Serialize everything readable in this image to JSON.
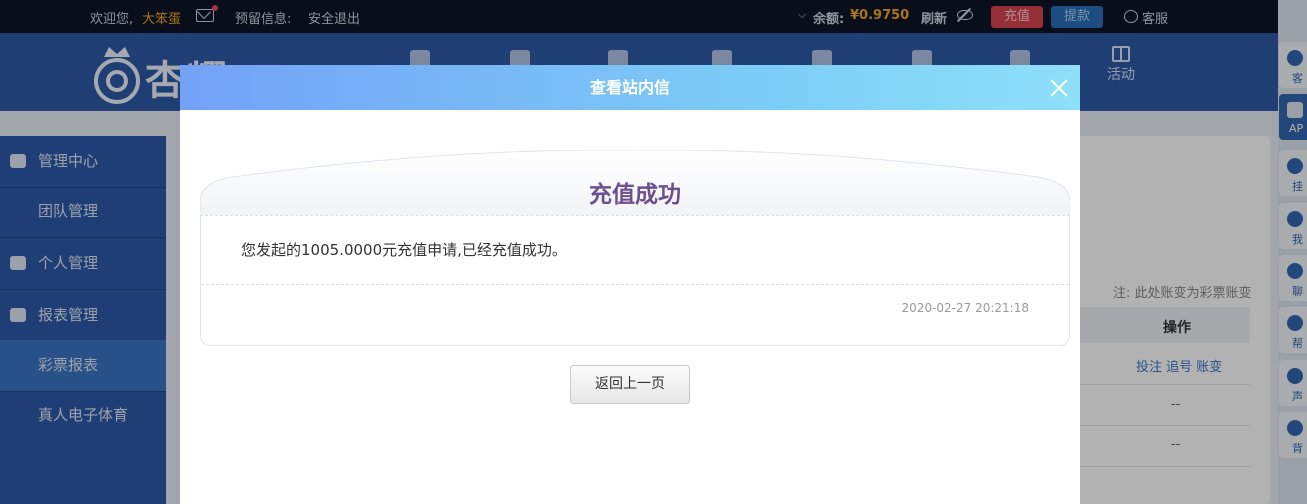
{
  "topbar": {
    "welcome": "欢迎您,",
    "username": "大笨蛋",
    "reserved_info": "预留信息:",
    "logout": "安全退出",
    "balance_label": "余额:",
    "balance_value": "¥0.9750",
    "refresh": "刷新",
    "recharge": "充值",
    "withdraw": "提款",
    "service": "客服"
  },
  "brand": {
    "logo_text": "杏耀"
  },
  "nav": {
    "activity": "活动"
  },
  "sidebar": {
    "items": [
      {
        "label": "管理中心",
        "icon": "users-icon"
      },
      {
        "label": "团队管理"
      },
      {
        "label": "个人管理",
        "icon": "user-icon"
      },
      {
        "label": "报表管理",
        "icon": "report-icon"
      },
      {
        "label": "彩票报表"
      },
      {
        "label": "真人电子体育"
      }
    ]
  },
  "content": {
    "note": "注: 此处账变为彩票账变",
    "table": {
      "col_action": "操作",
      "row1_actions": "投注 追号 账变",
      "row2_actions": "--",
      "row3_actions": "--"
    }
  },
  "rightbar": {
    "items": [
      "客",
      "AP",
      "挂",
      "我",
      "聊",
      "帮",
      "声",
      "背"
    ]
  },
  "modal": {
    "title": "查看站内信",
    "letter_title": "充值成功",
    "message": "您发起的1005.0000元充值申请,已经充值成功。",
    "timestamp": "2020-02-27 20:21:18",
    "back_button": "返回上一页"
  },
  "colors": {
    "header_gradient_start": "#73a1f7",
    "header_gradient_end": "#8ee0f8",
    "letter_title": "#6b4f8e",
    "accent_gold": "#f3a624"
  }
}
